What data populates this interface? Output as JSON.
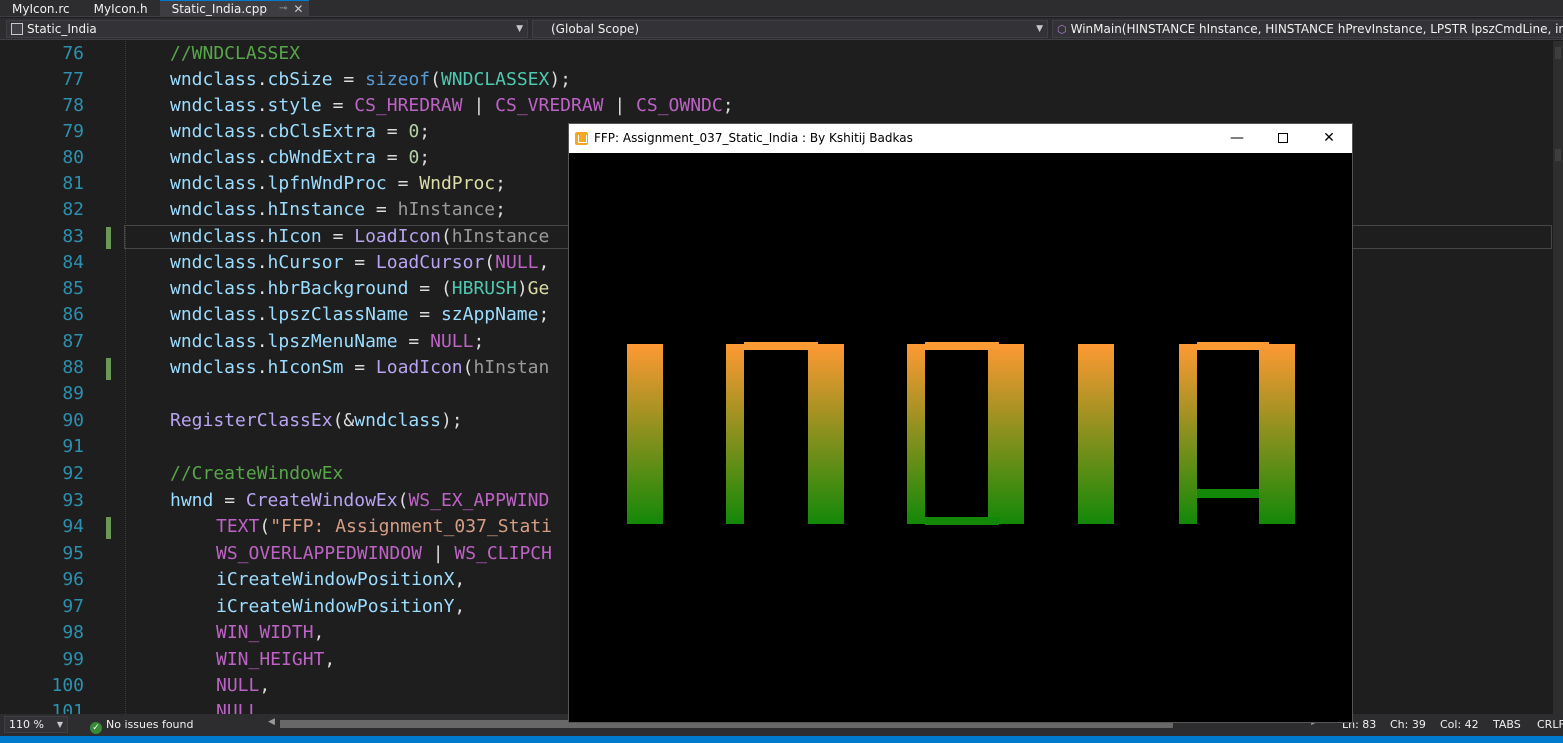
{
  "tabs": [
    {
      "label": "MyIcon.rc",
      "active": false
    },
    {
      "label": "MyIcon.h",
      "active": false
    },
    {
      "label": "Static_India.cpp",
      "active": true
    }
  ],
  "icons": {
    "pin": "pin-icon",
    "close": "close-icon",
    "dropdown": "chevron-down-icon",
    "method": "method-cube-icon",
    "project": "project-icon",
    "ok": "check-circle-icon"
  },
  "navbar": {
    "project": "Static_India",
    "scope": "(Global Scope)",
    "member": "WinMain(HINSTANCE hInstance, HINSTANCE hPrevInstance, LPSTR lpszCmdLine, int iCmdSh"
  },
  "editor": {
    "line_numbers": [
      "76",
      "77",
      "78",
      "79",
      "80",
      "81",
      "82",
      "83",
      "84",
      "85",
      "86",
      "87",
      "88",
      "89",
      "90",
      "91",
      "92",
      "93",
      "94",
      "95",
      "96",
      "97",
      "98",
      "99",
      "100",
      "101"
    ],
    "lines": {
      "l76": {
        "comment": "//WNDCLASSEX"
      },
      "l77": {
        "a": "wndclass",
        "b": ".",
        "c": "cbSize",
        "d": " = ",
        "e": "sizeof",
        "f": "(",
        "g": "WNDCLASSEX",
        "h": ");"
      },
      "l78": {
        "a": "wndclass",
        "b": ".",
        "c": "style",
        "d": " = ",
        "e": "CS_HREDRAW",
        "f": " | ",
        "g": "CS_VREDRAW",
        "h": " | ",
        "i": "CS_OWNDC",
        "j": ";"
      },
      "l79": {
        "a": "wndclass",
        "b": ".",
        "c": "cbClsExtra",
        "d": " = ",
        "e": "0",
        "f": ";"
      },
      "l80": {
        "a": "wndclass",
        "b": ".",
        "c": "cbWndExtra",
        "d": " = ",
        "e": "0",
        "f": ";"
      },
      "l81": {
        "a": "wndclass",
        "b": ".",
        "c": "lpfnWndProc",
        "d": " = ",
        "e": "WndProc",
        "f": ";"
      },
      "l82": {
        "a": "wndclass",
        "b": ".",
        "c": "hInstance",
        "d": " = ",
        "e": "hInstance",
        "f": ";"
      },
      "l83": {
        "a": "wndclass",
        "b": ".",
        "c": "hIcon",
        "d": " = ",
        "e": "LoadIcon",
        "f": "(",
        "g": "hInstance"
      },
      "l84": {
        "a": "wndclass",
        "b": ".",
        "c": "hCursor",
        "d": " = ",
        "e": "LoadCursor",
        "f": "(",
        "g": "NULL",
        "h": ","
      },
      "l85": {
        "a": "wndclass",
        "b": ".",
        "c": "hbrBackground",
        "d": " = ",
        "e": "(",
        "f": "HBRUSH",
        "g": ")",
        "h": "Ge"
      },
      "l86": {
        "a": "wndclass",
        "b": ".",
        "c": "lpszClassName",
        "d": " = ",
        "e": "szAppName",
        "f": ";"
      },
      "l87": {
        "a": "wndclass",
        "b": ".",
        "c": "lpszMenuName",
        "d": " = ",
        "e": "NULL",
        "f": ";"
      },
      "l88": {
        "a": "wndclass",
        "b": ".",
        "c": "hIconSm",
        "d": " = ",
        "e": "LoadIcon",
        "f": "(",
        "g": "hInstan"
      },
      "l90": {
        "a": "RegisterClassEx",
        "b": "(&",
        "c": "wndclass",
        "d": ");"
      },
      "l92": {
        "comment": "//CreateWindowEx"
      },
      "l93": {
        "a": "hwnd",
        "b": " = ",
        "c": "CreateWindowEx",
        "d": "(",
        "e": "WS_EX_APPWIND"
      },
      "l94": {
        "a": "TEXT",
        "b": "(",
        "c": "\"FFP: Assignment_037_Stati"
      },
      "l95": {
        "a": "WS_OVERLAPPEDWINDOW",
        "b": " | ",
        "c": "WS_CLIPCH"
      },
      "l96": {
        "a": "iCreateWindowPositionX",
        "b": ","
      },
      "l97": {
        "a": "iCreateWindowPositionY",
        "b": ","
      },
      "l98": {
        "a": "WIN_WIDTH",
        "b": ","
      },
      "l99": {
        "a": "WIN_HEIGHT",
        "b": ","
      },
      "l100": {
        "a": "NULL",
        "b": ","
      },
      "l101": {
        "a": "NULL"
      }
    }
  },
  "window": {
    "title": "FFP: Assignment_037_Static_India : By Kshitij Badkas",
    "buttons": {
      "minimize": "—",
      "close": "✕"
    },
    "colors": {
      "saffron": "#FF9933",
      "green": "#138808",
      "background": "#000000"
    },
    "letters": [
      "I",
      "N",
      "D",
      "I",
      "A"
    ]
  },
  "status": {
    "zoom": "110 %",
    "issues": "No issues found",
    "ln": "Ln: 83",
    "ch": "Ch: 39",
    "col": "Col: 42",
    "tabs": "TABS",
    "eol": "CRLF"
  }
}
